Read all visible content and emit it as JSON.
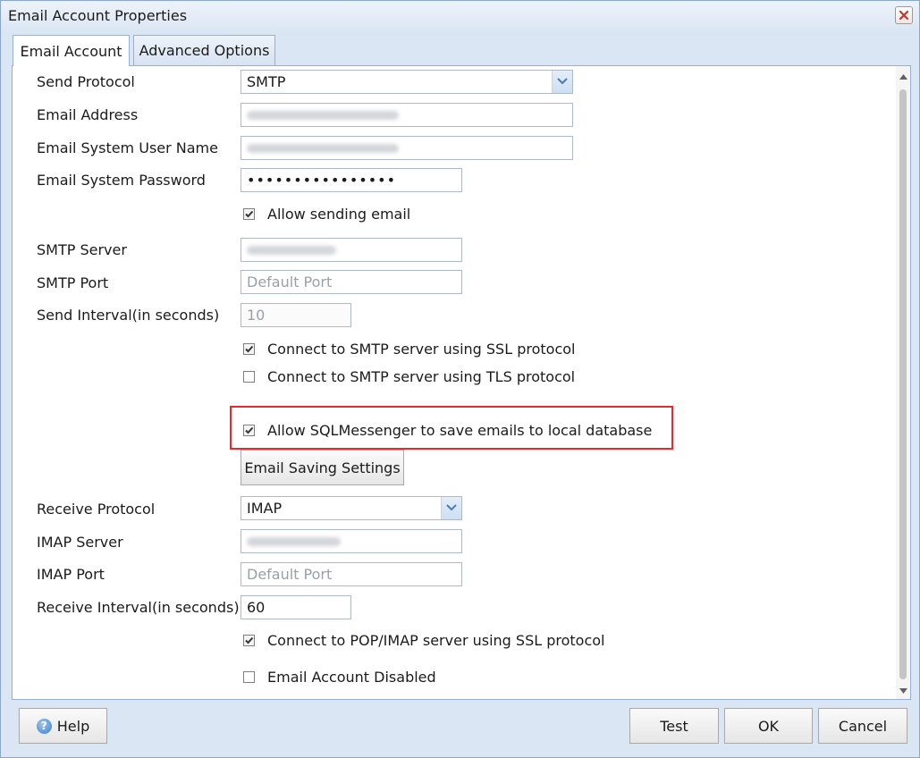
{
  "window": {
    "title": "Email Account Properties"
  },
  "tabs": [
    "Email Account",
    "Advanced Options"
  ],
  "form": {
    "send_protocol": {
      "label": "Send Protocol",
      "value": "SMTP"
    },
    "email_address": {
      "label": "Email Address"
    },
    "user_name": {
      "label": "Email System User Name"
    },
    "password": {
      "label": "Email System Password",
      "value": "••••••••••••••••"
    },
    "allow_sending": {
      "label": "Allow sending email",
      "checked": true
    },
    "smtp_server": {
      "label": "SMTP Server"
    },
    "smtp_port": {
      "label": "SMTP Port",
      "placeholder": "Default Port"
    },
    "send_interval": {
      "label": "Send Interval(in seconds)",
      "value": "10"
    },
    "smtp_ssl": {
      "label": "Connect to SMTP server using SSL protocol",
      "checked": true
    },
    "smtp_tls": {
      "label": "Connect to SMTP server using TLS protocol",
      "checked": false
    },
    "save_local": {
      "label": "Allow SQLMessenger to save emails to local database",
      "checked": true
    },
    "saving_settings_button": "Email Saving Settings",
    "receive_protocol": {
      "label": "Receive Protocol",
      "value": "IMAP"
    },
    "imap_server": {
      "label": "IMAP Server"
    },
    "imap_port": {
      "label": "IMAP Port",
      "placeholder": "Default Port"
    },
    "receive_interval": {
      "label": "Receive Interval(in seconds)",
      "value": "60"
    },
    "imap_ssl": {
      "label": "Connect to POP/IMAP server using SSL protocol",
      "checked": true
    },
    "account_disabled": {
      "label": "Email Account Disabled",
      "checked": false
    }
  },
  "footer": {
    "help": "Help",
    "test": "Test",
    "ok": "OK",
    "cancel": "Cancel"
  },
  "colors": {
    "highlight": "#e52b31",
    "background": "#dbe6f4",
    "border": "#95b0d2"
  }
}
